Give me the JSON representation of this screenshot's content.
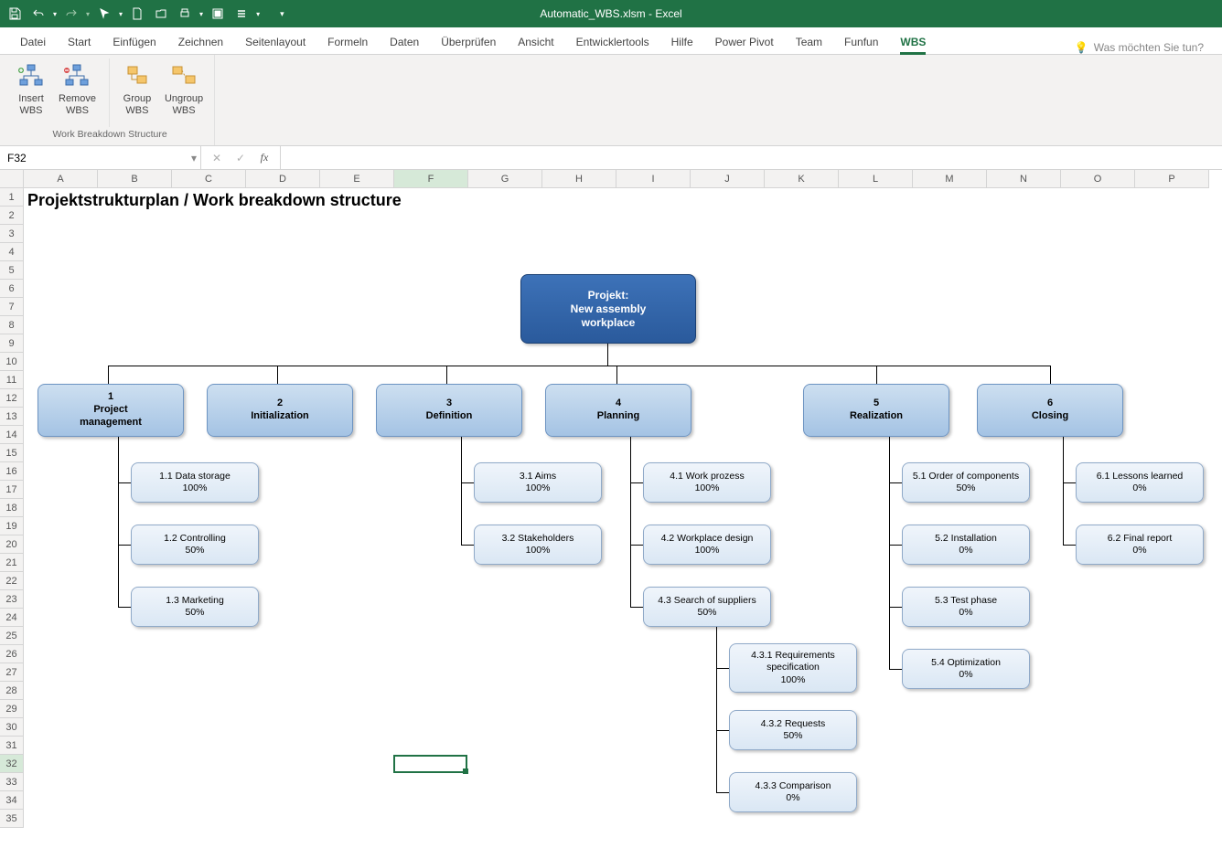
{
  "app": {
    "title": "Automatic_WBS.xlsm  -  Excel"
  },
  "qat": {
    "save": "save",
    "undo": "undo",
    "redo": "redo",
    "pointer": "pointer",
    "new": "new",
    "open": "open",
    "print": "print",
    "preview": "preview",
    "merge": "merge",
    "list": "list"
  },
  "tabs": {
    "file": "Datei",
    "start": "Start",
    "einfugen": "Einfügen",
    "zeichnen": "Zeichnen",
    "seitenlayout": "Seitenlayout",
    "formeln": "Formeln",
    "daten": "Daten",
    "uberprufen": "Überprüfen",
    "ansicht": "Ansicht",
    "entwicklertools": "Entwicklertools",
    "hilfe": "Hilfe",
    "powerpivot": "Power Pivot",
    "team": "Team",
    "funfun": "Funfun",
    "wbs": "WBS"
  },
  "tellme": "Was möchten Sie tun?",
  "ribbon": {
    "group_title": "Work Breakdown Structure",
    "insert": "Insert\nWBS",
    "remove": "Remove\nWBS",
    "group": "Group\nWBS",
    "ungroup": "Ungroup\nWBS"
  },
  "namebox": "F32",
  "columns": [
    "A",
    "B",
    "C",
    "D",
    "E",
    "F",
    "G",
    "H",
    "I",
    "J",
    "K",
    "L",
    "M",
    "N",
    "O",
    "P"
  ],
  "rows": [
    "1",
    "2",
    "3",
    "4",
    "5",
    "6",
    "7",
    "8",
    "9",
    "10",
    "11",
    "12",
    "13",
    "14",
    "15",
    "16",
    "17",
    "18",
    "19",
    "20",
    "21",
    "22",
    "23",
    "24",
    "25",
    "26",
    "27",
    "28",
    "29",
    "30",
    "31",
    "32",
    "33",
    "34",
    "35"
  ],
  "heading": "Projektstrukturplan / Work breakdown structure",
  "selected_col": "F",
  "selected_row": "32",
  "wbs": {
    "root_l1": "Projekt:",
    "root_l2": "New assembly",
    "root_l3": "workplace",
    "n1_num": "1",
    "n1_name": "Project\nmanagement",
    "n2_num": "2",
    "n2_name": "Initialization",
    "n3_num": "3",
    "n3_name": "Definition",
    "n4_num": "4",
    "n4_name": "Planning",
    "n5_num": "5",
    "n5_name": "Realization",
    "n6_num": "6",
    "n6_name": "Closing",
    "t11": "1.1 Data storage",
    "p11": "100%",
    "t12": "1.2 Controlling",
    "p12": "50%",
    "t13": "1.3 Marketing",
    "p13": "50%",
    "t31": "3.1 Aims",
    "p31": "100%",
    "t32": "3.2 Stakeholders",
    "p32": "100%",
    "t41": "4.1 Work prozess",
    "p41": "100%",
    "t42": "4.2 Workplace design",
    "p42": "100%",
    "t43": "4.3 Search of suppliers",
    "p43": "50%",
    "t431": "4.3.1 Requirements\nspecification",
    "p431": "100%",
    "t432": "4.3.2 Requests",
    "p432": "50%",
    "t433": "4.3.3 Comparison",
    "p433": "0%",
    "t51": "5.1 Order of components",
    "p51": "50%",
    "t52": "5.2 Installation",
    "p52": "0%",
    "t53": "5.3 Test phase",
    "p53": "0%",
    "t54": "5.4 Optimization",
    "p54": "0%",
    "t61": "6.1 Lessons learned",
    "p61": "0%",
    "t62": "6.2 Final report",
    "p62": "0%"
  }
}
